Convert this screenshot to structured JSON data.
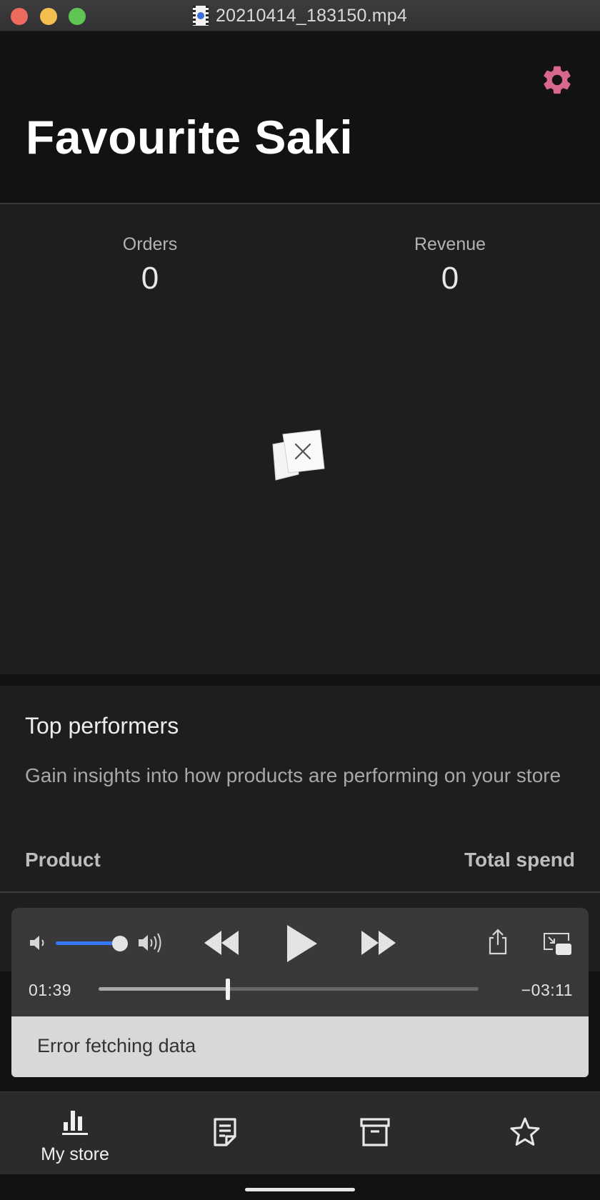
{
  "window": {
    "title": "20210414_183150.mp4",
    "file_icon": "video-file-icon"
  },
  "header": {
    "store_name": "Favourite Saki",
    "settings_icon": "gear-icon",
    "accent_color": "#d9668f"
  },
  "stats": {
    "orders_label": "Orders",
    "orders_value": "0",
    "revenue_label": "Revenue",
    "revenue_value": "0",
    "empty_state_icon": "no-data-icon"
  },
  "top_performers": {
    "title": "Top performers",
    "description": "Gain insights into how products are performing on your store",
    "column_product": "Product",
    "column_total_spend": "Total spend"
  },
  "player": {
    "elapsed": "01:39",
    "remaining": "−03:11",
    "progress_fraction": 0.34,
    "volume_fraction": 0.9,
    "icons": [
      "volume-low-icon",
      "volume-high-icon",
      "rewind-icon",
      "play-icon",
      "fast-forward-icon",
      "share-icon",
      "picture-in-picture-icon"
    ],
    "accent_color": "#3478f6"
  },
  "snackbar": {
    "message": "Error fetching data"
  },
  "bottom_nav": {
    "items": [
      {
        "label": "My store",
        "icon": "bar-chart-icon"
      },
      {
        "label": "",
        "icon": "orders-icon"
      },
      {
        "label": "",
        "icon": "products-box-icon"
      },
      {
        "label": "",
        "icon": "star-icon"
      }
    ]
  }
}
